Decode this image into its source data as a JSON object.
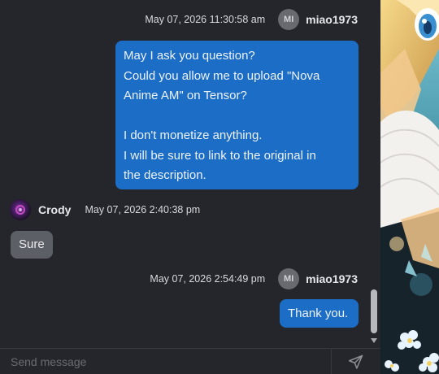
{
  "messages": [
    {
      "sender": "miao1973",
      "avatar_initials": "MI",
      "timestamp": "May 07, 2026 11:30:58 am",
      "lines": [
        "May I ask you question?",
        "Could you allow me to upload \"Nova",
        "Anime AM\" on Tensor?",
        "",
        "I don't monetize anything.",
        "I will be sure to link to the original in",
        "the description."
      ]
    },
    {
      "sender": "Crody",
      "timestamp": "May 07, 2026 2:40:38 pm",
      "text": "Sure"
    },
    {
      "sender": "miao1973",
      "avatar_initials": "MI",
      "timestamp": "May 07, 2026 2:54:49 pm",
      "text": "Thank you."
    }
  ],
  "composer": {
    "placeholder": "Send message"
  },
  "icons": {
    "send": "send-icon",
    "scroll_down": "chevron-down-icon"
  },
  "colors": {
    "outgoing_bubble": "#1c6dc6",
    "incoming_bubble": "#5c5f66",
    "panel_background": "#25262b"
  }
}
